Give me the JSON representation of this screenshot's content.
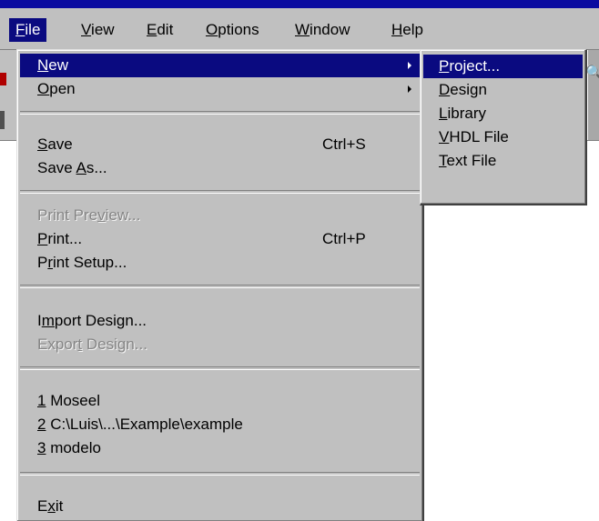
{
  "menubar": [
    {
      "pre": "",
      "key": "F",
      "post": "ile",
      "active": true
    },
    {
      "pre": "",
      "key": "V",
      "post": "iew"
    },
    {
      "pre": "",
      "key": "E",
      "post": "dit"
    },
    {
      "pre": "",
      "key": "O",
      "post": "ptions"
    },
    {
      "pre": "",
      "key": "W",
      "post": "indow"
    },
    {
      "pre": "",
      "key": "H",
      "post": "elp"
    }
  ],
  "file_menu": {
    "new": {
      "pre": "",
      "key": "N",
      "post": "ew",
      "state": "highlighted",
      "submenu": true
    },
    "open": {
      "pre": "",
      "key": "O",
      "post": "pen",
      "submenu": true
    },
    "save": {
      "pre": "",
      "key": "S",
      "post": "ave",
      "shortcut": "Ctrl+S"
    },
    "save_as": {
      "pre": "Save ",
      "key": "A",
      "post": "s..."
    },
    "print_preview": {
      "pre": "Print Pre",
      "key": "v",
      "post": "iew...",
      "state": "disabled"
    },
    "print": {
      "pre": "",
      "key": "P",
      "post": "rint...",
      "shortcut": "Ctrl+P"
    },
    "print_setup": {
      "pre": "P",
      "key": "r",
      "post": "int Setup..."
    },
    "import_design": {
      "pre": "I",
      "key": "m",
      "post": "port Design..."
    },
    "export_design": {
      "pre": "Expor",
      "key": "t",
      "post": " Design...",
      "state": "disabled"
    },
    "recent_1": {
      "pre": "",
      "key": "1",
      "post": " Moseel"
    },
    "recent_2": {
      "pre": "",
      "key": "2",
      "post": " C:\\Luis\\...\\Example\\example"
    },
    "recent_3": {
      "pre": "",
      "key": "3",
      "post": " modelo"
    },
    "exit": {
      "pre": "E",
      "key": "x",
      "post": "it"
    }
  },
  "new_submenu": {
    "project": {
      "pre": "",
      "key": "P",
      "post": "roject...",
      "state": "highlighted"
    },
    "design": {
      "pre": "",
      "key": "D",
      "post": "esign"
    },
    "library": {
      "pre": "",
      "key": "L",
      "post": "ibrary"
    },
    "vhdl": {
      "pre": "",
      "key": "V",
      "post": "HDL File"
    },
    "text": {
      "pre": "",
      "key": "T",
      "post": "ext File"
    }
  },
  "colors": {
    "menu_bg": "#c0c0c0",
    "highlight": "#0a0a80",
    "title_bar": "#0a0aa0",
    "disabled_text": "#868686"
  },
  "icons": {
    "submenu_arrow": "triangle-right",
    "toolbar_search": "magnifier"
  }
}
